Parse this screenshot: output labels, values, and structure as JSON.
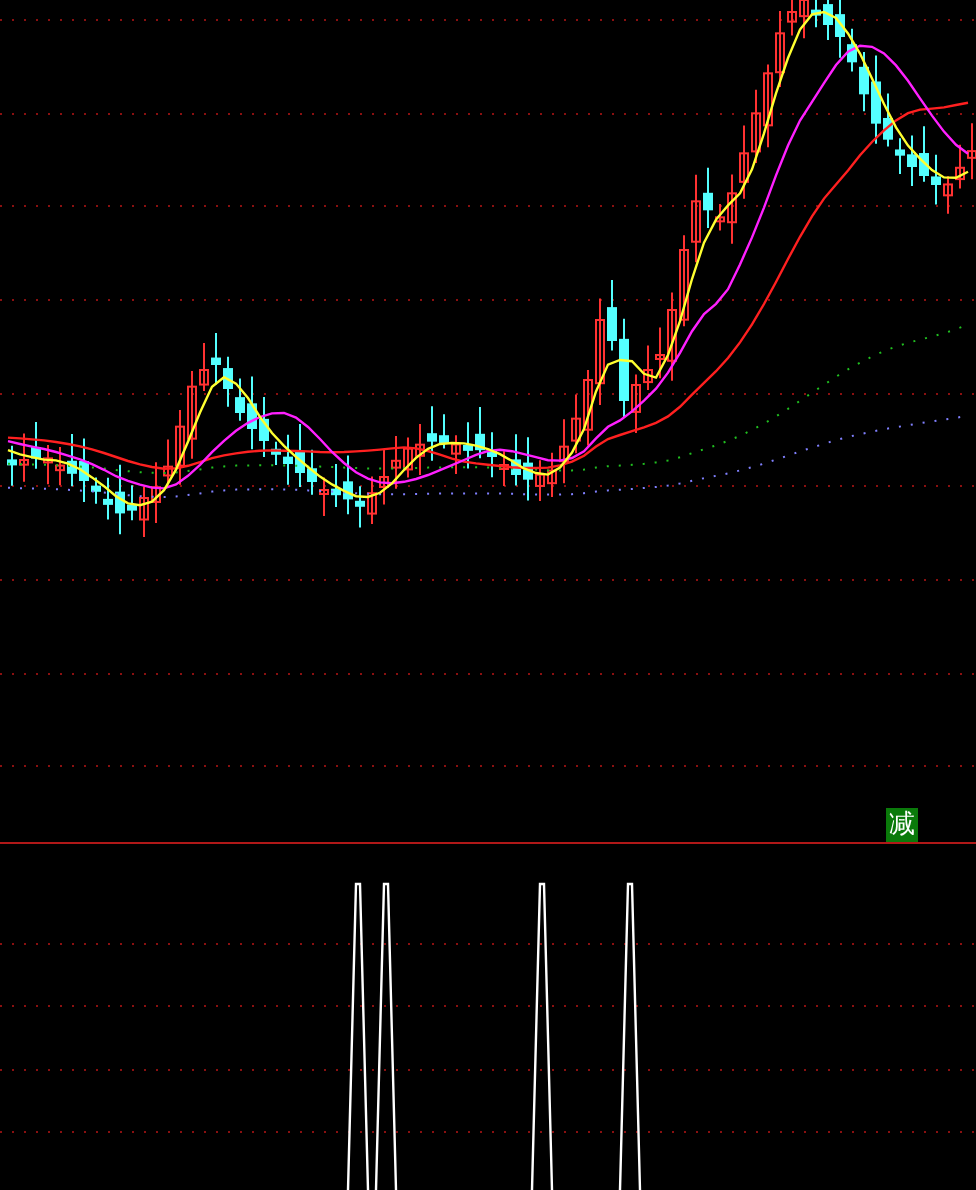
{
  "badge": {
    "text": "减"
  }
}
